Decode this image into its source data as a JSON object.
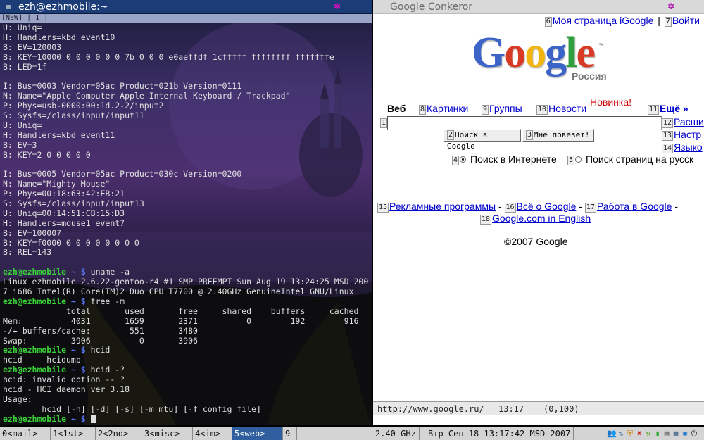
{
  "terminal": {
    "title": "ezh@ezhmobile:~",
    "tab_label": "[NEW] | 1 |",
    "lines": [
      {
        "t": "U: Uniq="
      },
      {
        "t": "H: Handlers=kbd event10"
      },
      {
        "t": "B: EV=120003"
      },
      {
        "t": "B: KEY=10000 0 0 0 0 0 0 7b 0 0 0 e0aeffdf 1cfffff ffffffff fffffffe"
      },
      {
        "t": "B: LED=1f"
      },
      {
        "t": ""
      },
      {
        "t": "I: Bus=0003 Vendor=05ac Product=021b Version=0111"
      },
      {
        "t": "N: Name=\"Apple Computer Apple Internal Keyboard / Trackpad\""
      },
      {
        "t": "P: Phys=usb-0000:00:1d.2-2/input2"
      },
      {
        "t": "S: Sysfs=/class/input/input11"
      },
      {
        "t": "U: Uniq="
      },
      {
        "t": "H: Handlers=kbd event11"
      },
      {
        "t": "B: EV=3"
      },
      {
        "t": "B: KEY=2 0 0 0 0 0"
      },
      {
        "t": ""
      },
      {
        "t": "I: Bus=0005 Vendor=05ac Product=030c Version=0200"
      },
      {
        "t": "N: Name=\"Mighty Mouse\""
      },
      {
        "t": "P: Phys=00:18:63:42:EB:21"
      },
      {
        "t": "S: Sysfs=/class/input/input13"
      },
      {
        "t": "U: Uniq=00:14:51:CB:15:D3"
      },
      {
        "t": "H: Handlers=mouse1 event7"
      },
      {
        "t": "B: EV=100007"
      },
      {
        "t": "B: KEY=f0000 0 0 0 0 0 0 0 0"
      },
      {
        "t": "B: REL=143"
      },
      {
        "t": ""
      },
      {
        "user": "ezh@ezhmobile",
        "path": "~",
        "cmd": "uname -a"
      },
      {
        "t": "Linux ezhmobile 2.6.22-gentoo-r4 #1 SMP PREEMPT Sun Aug 19 13:24:25 MSD 200"
      },
      {
        "t": "7 i686 Intel(R) Core(TM)2 Duo CPU T7700 @ 2.40GHz GenuineIntel GNU/Linux"
      },
      {
        "user": "ezh@ezhmobile",
        "path": "~",
        "cmd": "free -m"
      },
      {
        "t": "             total       used       free     shared    buffers     cached"
      },
      {
        "t": "Mem:          4031       1659       2371          0        192        916"
      },
      {
        "t": "-/+ buffers/cache:        551       3480"
      },
      {
        "t": "Swap:         3906          0       3906"
      },
      {
        "user": "ezh@ezhmobile",
        "path": "~",
        "cmd": "hcid"
      },
      {
        "t": "hcid     hcidump"
      },
      {
        "user": "ezh@ezhmobile",
        "path": "~",
        "cmd": "hcid -?"
      },
      {
        "t": "hcid: invalid option -- ?"
      },
      {
        "t": "hcid - HCI daemon ver 3.18"
      },
      {
        "t": "Usage:"
      },
      {
        "t": "        hcid [-n] [-d] [-s] [-m mtu] [-f config file]"
      },
      {
        "user": "ezh@ezhmobile",
        "path": "~",
        "cmd": "",
        "cursor": true
      }
    ],
    "prompt_symbol": "$"
  },
  "browser": {
    "title": "Google Conkeror",
    "top_links": [
      {
        "hint": "6",
        "label": "Моя страница iGoogle"
      },
      {
        "hint": "7",
        "label": "Войти"
      }
    ],
    "top_sep": "|",
    "logo": {
      "letters": [
        {
          "ch": "G",
          "color": "#3b63c8"
        },
        {
          "ch": "o",
          "color": "#d83b25"
        },
        {
          "ch": "o",
          "color": "#f2b50f"
        },
        {
          "ch": "g",
          "color": "#3b63c8"
        },
        {
          "ch": "l",
          "color": "#2f9e3c"
        },
        {
          "ch": "e",
          "color": "#d83b25"
        }
      ],
      "region": "Россия",
      "tm": "™"
    },
    "nav": {
      "current": "Веб",
      "items": [
        {
          "hint": "8",
          "label": "Картинки"
        },
        {
          "hint": "9",
          "label": "Группы"
        },
        {
          "hint": "10",
          "label": "Новости"
        }
      ],
      "new_badge": "Новинка!",
      "more": {
        "hint": "11",
        "label": "Ещё »"
      }
    },
    "search": {
      "hint": "1",
      "value": "",
      "btn_search": {
        "hint": "2",
        "label": "Поиск в Google"
      },
      "btn_lucky": {
        "hint": "3",
        "label": "Мне повезёт!"
      }
    },
    "side_links": [
      {
        "hint": "12",
        "label": "Расши"
      },
      {
        "hint": "13",
        "label": "Настр"
      },
      {
        "hint": "14",
        "label": "Языко"
      }
    ],
    "radios": [
      {
        "hint": "4",
        "label": "Поиск в Интернете",
        "checked": true
      },
      {
        "hint": "5",
        "label": "Поиск страниц на русск",
        "checked": false
      }
    ],
    "footer_links": [
      {
        "hint": "15",
        "label": "Рекламные программы"
      },
      {
        "hint": "16",
        "label": "Всё о Google"
      },
      {
        "hint": "17",
        "label": "Работа в Google"
      }
    ],
    "footer_sep": "-",
    "footer_link2": {
      "hint": "18",
      "label": "Google.com in English"
    },
    "copyright": "©2007 Google",
    "status": {
      "url": "http://www.google.ru/",
      "time": "13:17",
      "position": "(0,100)"
    }
  },
  "panel": {
    "workspaces": [
      {
        "label": "0<mail>",
        "active": false
      },
      {
        "label": "1<1st>",
        "active": false
      },
      {
        "label": "2<2nd>",
        "active": false
      },
      {
        "label": "3<misc>",
        "active": false
      },
      {
        "label": "4<im>",
        "active": false
      },
      {
        "label": "5<web>",
        "active": true
      },
      {
        "label": "9",
        "active": false
      }
    ],
    "cpu": "2.40 GHz",
    "clock": "Втр Сен 18 13:17:42 MSD 2007",
    "tray_icons": [
      "people-icon",
      "network-icon",
      "shield-icon",
      "close-tool-icon",
      "tools-icon",
      "battery-icon",
      "document-icon",
      "clipboard-icon",
      "globe-icon",
      "power-icon"
    ]
  },
  "colors": {
    "prompt_user": "#39d139",
    "prompt_path": "#5c7cff",
    "link": "#0000cc",
    "new_badge": "#cc0000",
    "active_workspace": "#2f5f9f"
  }
}
